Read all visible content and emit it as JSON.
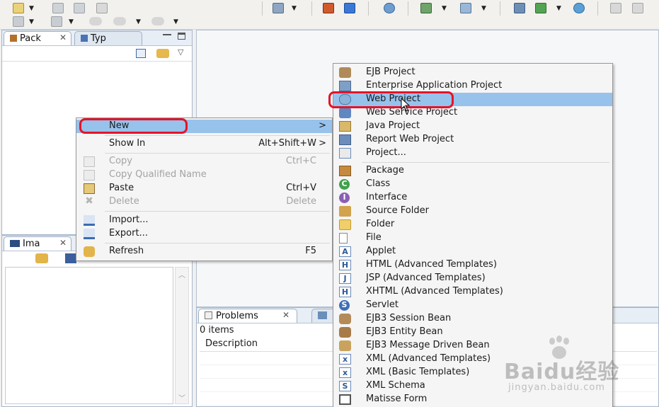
{
  "views": {
    "package_tab": "Pack",
    "type_tab": "Typ",
    "image_tab": "Ima",
    "problems_tab": "Problems",
    "problems_count": "0 items",
    "description_header": "Description"
  },
  "context_menu": {
    "new": "New",
    "show_in": "Show In",
    "show_in_shortcut": "Alt+Shift+W",
    "copy": "Copy",
    "copy_shortcut": "Ctrl+C",
    "copy_qualified": "Copy Qualified Name",
    "paste": "Paste",
    "paste_shortcut": "Ctrl+V",
    "delete": "Delete",
    "delete_shortcut": "Delete",
    "import": "Import...",
    "export": "Export...",
    "refresh": "Refresh",
    "refresh_shortcut": "F5",
    "submenu_arrow": ">"
  },
  "new_submenu": [
    "EJB Project",
    "Enterprise Application Project",
    "Web Project",
    "Web Service Project",
    "Java Project",
    "Report Web Project",
    "Project...",
    "Package",
    "Class",
    "Interface",
    "Source Folder",
    "Folder",
    "File",
    "Applet",
    "HTML (Advanced Templates)",
    "JSP (Advanced Templates)",
    "XHTML (Advanced Templates)",
    "Servlet",
    "EJB3 Session Bean",
    "EJB3 Entity Bean",
    "EJB3 Message Driven Bean",
    "XML (Advanced Templates)",
    "XML (Basic Templates)",
    "XML Schema",
    "Matisse Form"
  ],
  "watermark": {
    "logo": "Baidu经验",
    "url": "jingyan.baidu.com"
  },
  "colors": {
    "highlight": "#97c2ec",
    "annotation": "#e3142a"
  }
}
